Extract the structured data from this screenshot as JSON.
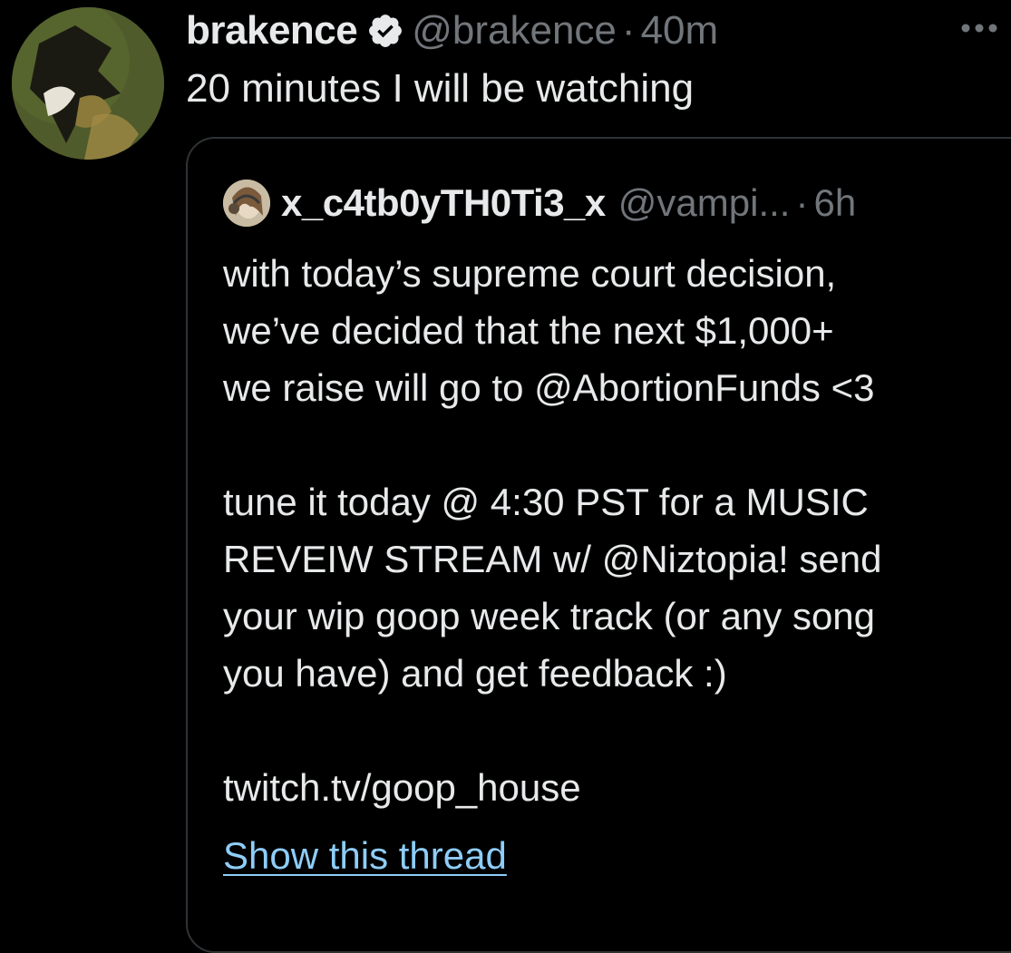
{
  "tweet": {
    "display_name": "brakence",
    "verified_icon": "verified-badge-icon",
    "handle": "@brakence",
    "separator": "·",
    "time": "40m",
    "more_icon": "more-options-icon",
    "text": "20 minutes I will be watching"
  },
  "quote": {
    "display_name": "x_c4tb0yTH0Ti3_x",
    "handle": "@vampi...",
    "separator": "·",
    "time": "6h",
    "lines": [
      "with today’s supreme court decision,",
      "we’ve decided that the next $1,000+",
      "we raise will go to @AbortionFunds <3",
      "",
      "tune it today @ 4:30 PST for a MUSIC",
      "REVEIW STREAM w/ @Niztopia! send",
      "your wip goop week track (or any song",
      "you have) and get feedback :)",
      "",
      "twitch.tv/goop_house"
    ],
    "show_thread": "Show this thread"
  },
  "colors": {
    "background": "#000000",
    "text_primary": "#e7e9ea",
    "text_secondary": "#71767b",
    "link": "#8ecdf8",
    "border": "#2f3336"
  }
}
